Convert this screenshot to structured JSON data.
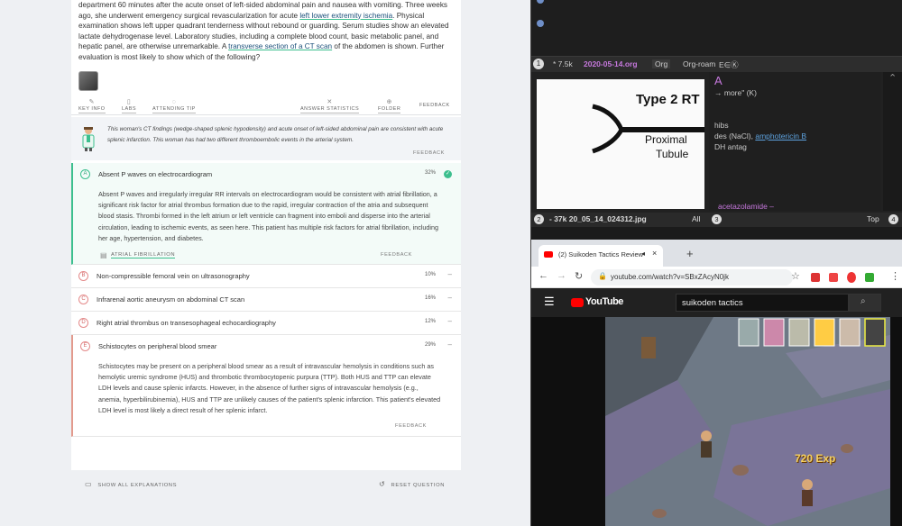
{
  "question": {
    "stem_parts": [
      "department 60 minutes after the acute onset of left-sided abdominal pain and nausea with vomiting. Three weeks ago, she underwent emergency surgical revascularization for acute ",
      "left lower extremity ischemia",
      ". Physical examination shows left upper quadrant tenderness without rebound or guarding. Serum studies show an elevated lactate dehydrogenase level. Laboratory studies, including a complete blood count, basic metabolic panel, and hepatic panel, are otherwise unremarkable. A ",
      "transverse section of a CT scan",
      " of the abdomen is shown. Further evaluation is most likely to show which of the following?"
    ]
  },
  "toolbar": {
    "key_info": "KEY INFO",
    "labs": "LABS",
    "attending_tip": "ATTENDING TIP",
    "answer_statistics": "ANSWER STATISTICS",
    "folder": "FOLDER",
    "feedback": "FEEDBACK"
  },
  "tip": {
    "text": "This woman's CT findings (wedge-shaped splenic hypodensity) and acute onset of left-sided abdominal pain are consistent with acute splenic infarction. This woman has had two different thromboembolic events in the arterial system.",
    "feedback": "FEEDBACK"
  },
  "answers": [
    {
      "letter": "A",
      "text": "Absent P waves on electrocardiogram",
      "pct": "32%",
      "explanation": "Absent P waves and irregularly irregular RR intervals on electrocardiogram would be consistent with atrial fibrillation, a significant risk factor for atrial thrombus formation due to the rapid, irregular contraction of the atria and subsequent blood stasis. Thrombi formed in the left atrium or left ventricle can fragment into emboli and disperse into the arterial circulation, leading to ischemic events, as seen here. This patient has multiple risk factors for atrial fibrillation, including her age, hypertension, and diabetes.",
      "link": "ATRIAL FIBRILLATION",
      "feedback": "FEEDBACK"
    },
    {
      "letter": "B",
      "text": "Non-compressible femoral vein on ultrasonography",
      "pct": "10%"
    },
    {
      "letter": "C",
      "text": "Infrarenal aortic aneurysm on abdominal CT scan",
      "pct": "16%"
    },
    {
      "letter": "D",
      "text": "Right atrial thrombus on transesophageal echocardiography",
      "pct": "12%"
    },
    {
      "letter": "E",
      "text": "Schistocytes on peripheral blood smear",
      "pct": "29%",
      "explanation": "Schistocytes may be present on a peripheral blood smear as a result of intravascular hemolysis in conditions such as hemolytic uremic syndrome (HUS) and thrombotic thrombocytopenic purpura (TTP). Both HUS and TTP can elevate LDH levels and cause splenic infarcts. However, in the absence of further signs of intravascular hemolysis (e.g., anemia, hyperbilirubinemia), HUS and TTP are unlikely causes of the patient's splenic infarction. This patient's elevated LDH level is most likely a direct result of her splenic infarct.",
      "feedback": "FEEDBACK"
    }
  ],
  "bottom": {
    "show_all": "SHOW ALL EXPLANATIONS",
    "reset": "RESET QUESTION"
  },
  "emacs": {
    "win1": "1",
    "buffer_info": "* 7.5k",
    "buffer_name": "2020-05-14.org",
    "mode1": "Org",
    "mode2": "Org-roam",
    "mode_glyphs": "E∈Ⓚ",
    "image_title": "Type 2 RT",
    "image_label1": "Proximal",
    "image_label2": "Tubule",
    "org_lines": [
      "A",
      "→ more\" (K)",
      "hibs",
      "des (NaCl), ",
      "DH antag",
      "acetazolamide –"
    ],
    "org_link": "amphotericin B",
    "win2": "2",
    "image_buffer": "- 37k 20_05_14_024312.jpg",
    "all": "All",
    "win3": "3",
    "top": "Top",
    "win4": "4"
  },
  "chrome": {
    "tab_title": "(2) Suikoden Tactics Review",
    "url": "youtube.com/watch?v=SBxZAcyN0jk",
    "search_value": "suikoden tactics",
    "yt_logo": "YouTube",
    "exp_text": "720 Exp"
  },
  "colors": {
    "accent_green": "#3cbf8e",
    "wrong_red": "#e48a8a",
    "emacs_purple": "#c678dd"
  }
}
